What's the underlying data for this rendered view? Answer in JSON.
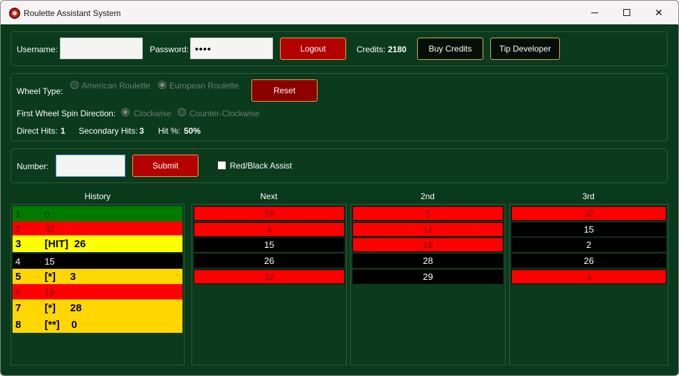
{
  "window": {
    "title": "Roulette Assistant System",
    "controls": {
      "minimize": "minimize",
      "maximize": "maximize",
      "close": "✕"
    }
  },
  "account": {
    "username_label": "Username:",
    "username_value": "",
    "password_label": "Password:",
    "password_value": "••••",
    "logout_label": "Logout",
    "credits_label": "Credits:",
    "credits_value": "2180",
    "buy_credits_label": "Buy Credits",
    "tip_developer_label": "Tip Developer"
  },
  "settings": {
    "wheel_type_label": "Wheel Type:",
    "wheel_options": [
      "American Roulette",
      "European Roulette"
    ],
    "wheel_selected": "European Roulette",
    "reset_label": "Reset",
    "spin_direction_label": "First Wheel Spin Direction:",
    "spin_options": [
      "Clockwise",
      "Counter-Clockwise"
    ],
    "spin_selected": "Clockwise",
    "stats": {
      "direct_hits_label": "Direct Hits:",
      "direct_hits_value": "1",
      "secondary_hits_label": "Secondary Hits:",
      "secondary_hits_value": "3",
      "hit_pct_label": "Hit %:",
      "hit_pct_value": "50%"
    }
  },
  "entry": {
    "number_label": "Number:",
    "number_value": "",
    "submit_label": "Submit",
    "red_black_assist_label": "Red/Black Assist",
    "red_black_assist_checked": false
  },
  "columns": {
    "history_title": "History",
    "next_title": "Next",
    "second_title": "2nd",
    "third_title": "3rd"
  },
  "history": [
    {
      "index": "1",
      "text": "0",
      "color": "green"
    },
    {
      "index": "2",
      "text": "32",
      "color": "red"
    },
    {
      "index": "3",
      "text": "[HIT]  26",
      "color": "yellow"
    },
    {
      "index": "4",
      "text": "15",
      "color": "black"
    },
    {
      "index": "5",
      "text": "[*]     3",
      "color": "gold"
    },
    {
      "index": "6",
      "text": "19",
      "color": "red"
    },
    {
      "index": "7",
      "text": "[*]     28",
      "color": "gold"
    },
    {
      "index": "8",
      "text": "[**]    0",
      "color": "gold"
    }
  ],
  "next": [
    {
      "n": "19",
      "color": "red"
    },
    {
      "n": "3",
      "color": "red"
    },
    {
      "n": "15",
      "color": "black"
    },
    {
      "n": "26",
      "color": "black"
    },
    {
      "n": "32",
      "color": "red"
    }
  ],
  "second": [
    {
      "n": "3",
      "color": "red"
    },
    {
      "n": "12",
      "color": "red"
    },
    {
      "n": "18",
      "color": "red"
    },
    {
      "n": "28",
      "color": "black"
    },
    {
      "n": "29",
      "color": "black"
    }
  ],
  "third": [
    {
      "n": "32",
      "color": "red"
    },
    {
      "n": "15",
      "color": "black"
    },
    {
      "n": "2",
      "color": "black"
    },
    {
      "n": "26",
      "color": "black"
    },
    {
      "n": "3",
      "color": "red"
    }
  ],
  "colors": {
    "background": "#0a3a1c",
    "red": "#ff0000",
    "black": "#000000",
    "green": "#007a00",
    "hit": "#ffff00",
    "secondary": "#ffd700",
    "button_red": "#b30000"
  }
}
